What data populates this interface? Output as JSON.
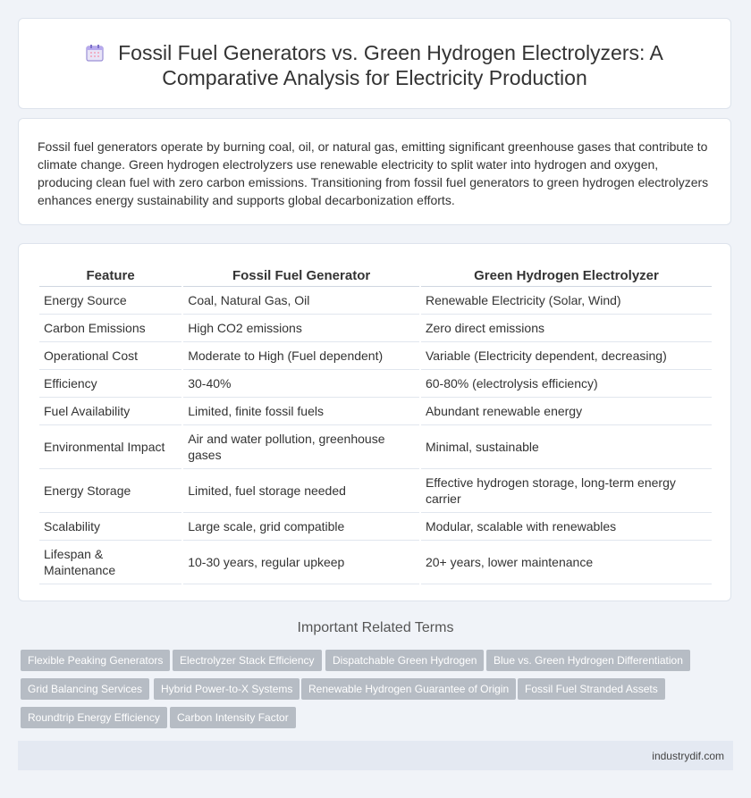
{
  "header": {
    "title_line1": "Fossil Fuel Generators vs. Green Hydrogen Electrolyzers: A",
    "title_line2": "Comparative Analysis for Electricity Production",
    "icon": "calendar-icon"
  },
  "intro": {
    "text": "Fossil fuel generators operate by burning coal, oil, or natural gas, emitting significant greenhouse gases that contribute to climate change. Green hydrogen electrolyzers use renewable electricity to split water into hydrogen and oxygen, producing clean fuel with zero carbon emissions. Transitioning from fossil fuel generators to green hydrogen electrolyzers enhances energy sustainability and supports global decarbonization efforts."
  },
  "table": {
    "headers": [
      "Feature",
      "Fossil Fuel Generator",
      "Green Hydrogen Electrolyzer"
    ],
    "rows": [
      [
        "Energy Source",
        "Coal, Natural Gas, Oil",
        "Renewable Electricity (Solar, Wind)"
      ],
      [
        "Carbon Emissions",
        "High CO2 emissions",
        "Zero direct emissions"
      ],
      [
        "Operational Cost",
        "Moderate to High (Fuel dependent)",
        "Variable (Electricity dependent, decreasing)"
      ],
      [
        "Efficiency",
        "30-40%",
        "60-80% (electrolysis efficiency)"
      ],
      [
        "Fuel Availability",
        "Limited, finite fossil fuels",
        "Abundant renewable energy"
      ],
      [
        "Environmental Impact",
        "Air and water pollution, greenhouse gases",
        "Minimal, sustainable"
      ],
      [
        "Energy Storage",
        "Limited, fuel storage needed",
        "Effective hydrogen storage, long-term energy carrier"
      ],
      [
        "Scalability",
        "Large scale, grid compatible",
        "Modular, scalable with renewables"
      ],
      [
        "Lifespan & Maintenance",
        "10-30 years, regular upkeep",
        "20+ years, lower maintenance"
      ]
    ]
  },
  "related": {
    "title": "Important Related Terms",
    "tags": [
      "Flexible Peaking Generators",
      "Electrolyzer Stack Efficiency",
      "Dispatchable Green Hydrogen",
      "Blue vs. Green Hydrogen Differentiation",
      "Grid Balancing Services",
      "Hybrid Power-to-X Systems",
      "Renewable Hydrogen Guarantee of Origin",
      "Fossil Fuel Stranded Assets",
      "Roundtrip Energy Efficiency",
      "Carbon Intensity Factor"
    ]
  },
  "footer": {
    "site": "industrydif.com"
  }
}
